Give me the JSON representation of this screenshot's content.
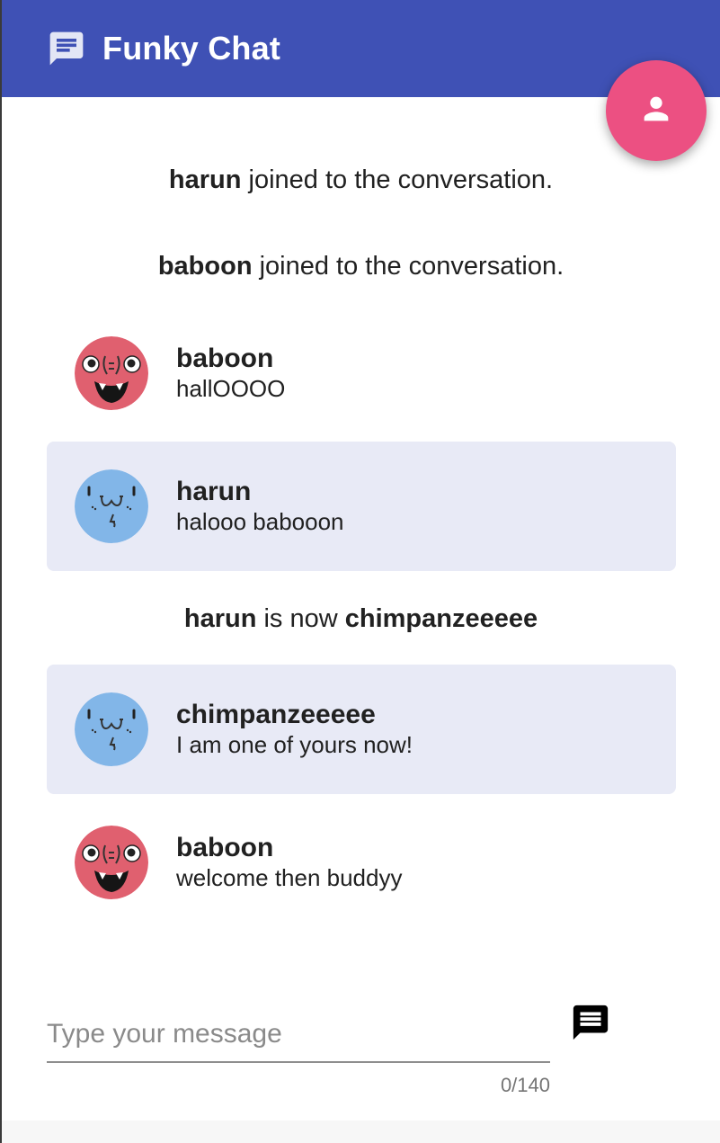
{
  "app": {
    "title": "Funky Chat",
    "logo_icon": "chat-bubble-icon",
    "fab_icon": "person-icon",
    "colors": {
      "primary": "#3f51b5",
      "accent": "#ec5082",
      "highlight": "#e8eaf6"
    }
  },
  "events": [
    {
      "user": "harun",
      "text": " joined to the conversation."
    },
    {
      "user": "baboon",
      "text": " joined to the conversation."
    },
    {
      "user_old": "harun",
      "middle": " is now ",
      "user_new": "chimpanzeeeee"
    }
  ],
  "messages": [
    {
      "author": "baboon",
      "text": "hallOOOO",
      "avatar": "baboon-face-avatar"
    },
    {
      "author": "harun",
      "text": "halooo babooon",
      "avatar": "harun-face-avatar"
    },
    {
      "author": "chimpanzeeeee",
      "text": "I am one of yours now!",
      "avatar": "harun-face-avatar"
    },
    {
      "author": "baboon",
      "text": "welcome then buddyy",
      "avatar": "baboon-face-avatar"
    }
  ],
  "composer": {
    "placeholder": "Type your message",
    "value": "",
    "counter": "0/140",
    "send_icon": "send-message-icon"
  }
}
